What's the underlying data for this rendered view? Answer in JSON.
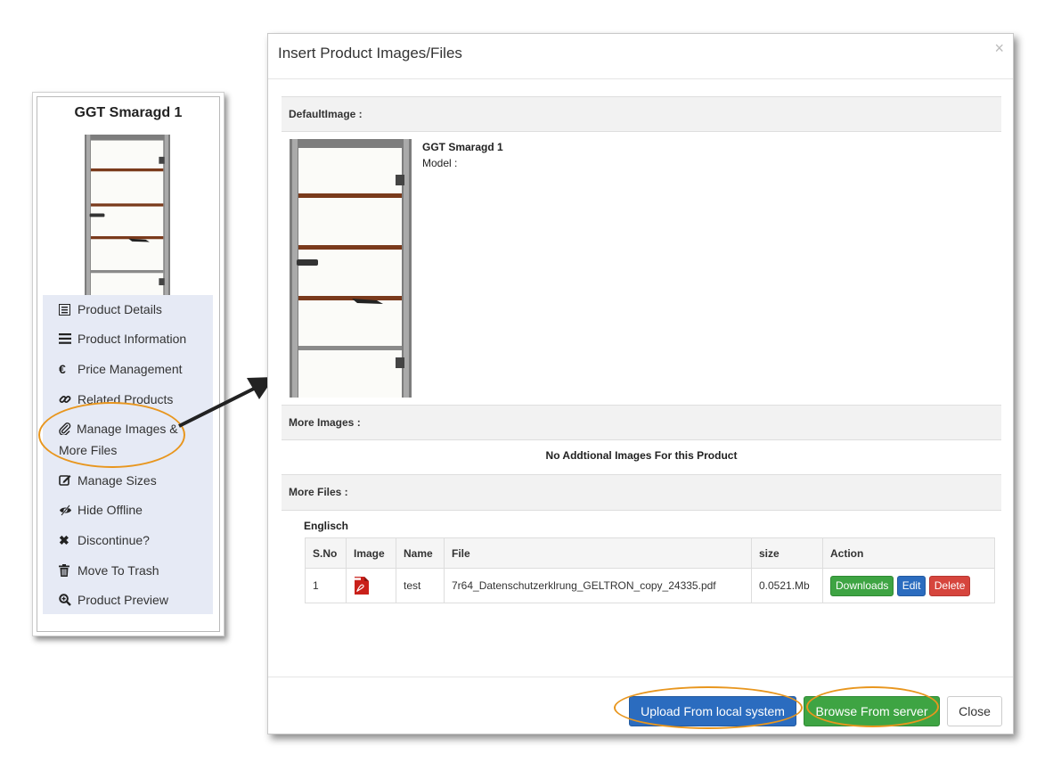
{
  "card": {
    "title": "GGT Smaragd 1",
    "menu": [
      {
        "icon": "list-icon",
        "label": "Product Details"
      },
      {
        "icon": "bars-icon",
        "label": "Product Information"
      },
      {
        "icon": "euro-icon",
        "label": "Price Management"
      },
      {
        "icon": "link-icon",
        "label": "Related Products"
      },
      {
        "icon": "paperclip-icon",
        "label": "Manage Images & More Files"
      },
      {
        "icon": "edit-icon",
        "label": "Manage Sizes"
      },
      {
        "icon": "eye-slash-icon",
        "label": "Hide Offline"
      },
      {
        "icon": "times-icon",
        "label": "Discontinue?"
      },
      {
        "icon": "trash-icon",
        "label": "Move To Trash"
      },
      {
        "icon": "zoom-icon",
        "label": "Product Preview"
      }
    ]
  },
  "modal": {
    "title": "Insert Product Images/Files",
    "close_glyph": "×",
    "default_image_label": "DefaultImage :",
    "product_name": "GGT Smaragd 1",
    "model_label": "Model :",
    "more_images_label": "More Images :",
    "no_images_text": "No Addtional Images For this Product",
    "more_files_label": "More Files :",
    "language": "Englisch",
    "table": {
      "headers": [
        "S.No",
        "Image",
        "Name",
        "File",
        "size",
        "Action"
      ],
      "rows": [
        {
          "sno": "1",
          "image_icon": "pdf-icon",
          "name": "test",
          "file": "7r64_Datenschutzerklrung_GELTRON_copy_24335.pdf",
          "size": "0.0521.Mb",
          "actions": [
            "Downloads",
            "Edit",
            "Delete"
          ]
        }
      ]
    },
    "footer": {
      "upload": "Upload From local system",
      "browse": "Browse From server",
      "close": "Close"
    }
  },
  "colors": {
    "highlight": "#e8961e",
    "primary": "#2b6cbf",
    "success": "#3ea443",
    "danger": "#d6453d",
    "menu_bg": "#e6eaf5"
  }
}
